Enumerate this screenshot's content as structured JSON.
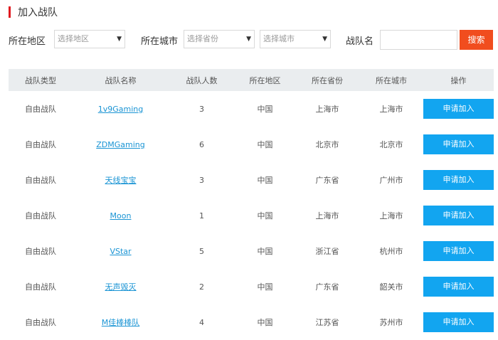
{
  "header": {
    "title": "加入战队"
  },
  "filters": {
    "region_label": "所在地区",
    "region_placeholder": "选择地区",
    "city_label": "所在城市",
    "province_placeholder": "选择省份",
    "city_placeholder": "选择城市",
    "team_name_label": "战队名",
    "team_name_value": "",
    "search_label": "搜索",
    "dropdown_arrow": "▼"
  },
  "table": {
    "columns": [
      "战队类型",
      "战队名称",
      "战队人数",
      "所在地区",
      "所在省份",
      "所在城市",
      "操作"
    ],
    "rows": [
      {
        "type": "自由战队",
        "name": "1v9Gaming",
        "count": "3",
        "region": "中国",
        "province": "上海市",
        "city": "上海市",
        "action": "申请加入"
      },
      {
        "type": "自由战队",
        "name": "ZDMGaming",
        "count": "6",
        "region": "中国",
        "province": "北京市",
        "city": "北京市",
        "action": "申请加入"
      },
      {
        "type": "自由战队",
        "name": "天线宝宝",
        "count": "3",
        "region": "中国",
        "province": "广东省",
        "city": "广州市",
        "action": "申请加入"
      },
      {
        "type": "自由战队",
        "name": "Moon",
        "count": "1",
        "region": "中国",
        "province": "上海市",
        "city": "上海市",
        "action": "申请加入"
      },
      {
        "type": "自由战队",
        "name": "VStar",
        "count": "5",
        "region": "中国",
        "province": "浙江省",
        "city": "杭州市",
        "action": "申请加入"
      },
      {
        "type": "自由战队",
        "name": "无声毁灭",
        "count": "2",
        "region": "中国",
        "province": "广东省",
        "city": "韶关市",
        "action": "申请加入"
      },
      {
        "type": "自由战队",
        "name": "M佳棒棒队",
        "count": "4",
        "region": "中国",
        "province": "江苏省",
        "city": "苏州市",
        "action": "申请加入"
      }
    ]
  },
  "colors": {
    "accent": "#e0191f",
    "search_button": "#f14d1e",
    "join_button": "#12a5f0",
    "link": "#1a94d4",
    "table_header_bg": "#eaedef"
  }
}
